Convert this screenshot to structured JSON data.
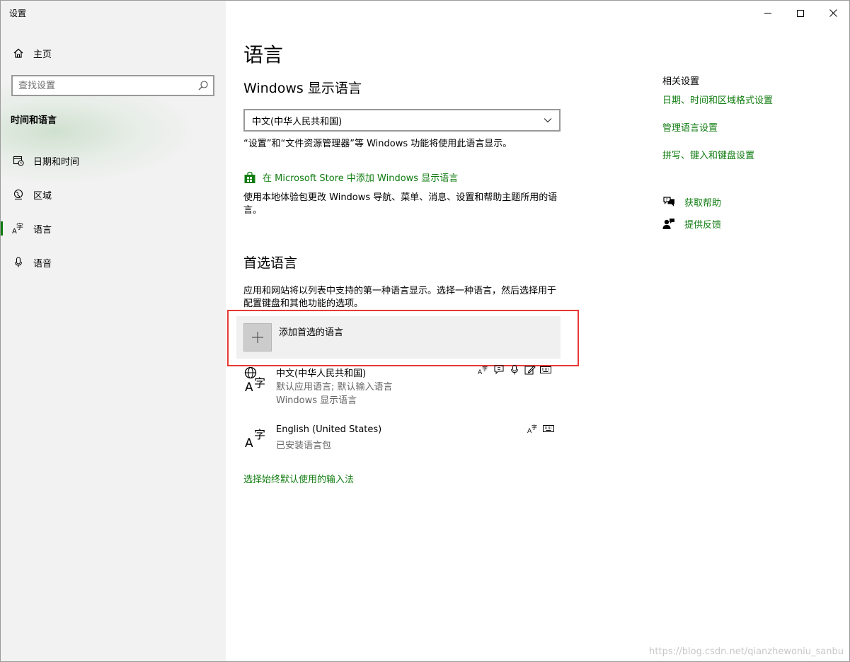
{
  "window": {
    "app_title": "设置",
    "controls": {
      "minimize": "minimize-icon",
      "maximize": "maximize-icon",
      "close": "close-icon"
    }
  },
  "sidebar": {
    "home_label": "主页",
    "search_placeholder": "查找设置",
    "section_title": "时间和语言",
    "items": [
      {
        "label": "日期和时间",
        "icon": "calendar-clock-icon"
      },
      {
        "label": "区域",
        "icon": "globe-icon"
      },
      {
        "label": "语言",
        "icon": "language-icon",
        "active": true
      },
      {
        "label": "语音",
        "icon": "microphone-icon"
      }
    ]
  },
  "main": {
    "title": "语言",
    "display_language": {
      "heading": "Windows 显示语言",
      "selected": "中文(中华人民共和国)",
      "description": "“设置”和“文件资源管理器”等 Windows 功能将使用此语言显示。",
      "store_link": "在 Microsoft Store 中添加 Windows 显示语言",
      "store_description": "使用本地体验包更改 Windows 导航、菜单、消息、设置和帮助主题所用的语言。"
    },
    "preferred": {
      "heading": "首选语言",
      "description": "应用和网站将以列表中支持的第一种语言显示。选择一种语言，然后选择用于配置键盘和其他功能的选项。",
      "add_label": "添加首选的语言",
      "languages": [
        {
          "name": "中文(中华人民共和国)",
          "sub1": "默认应用语言; 默认输入语言",
          "sub2": "Windows 显示语言"
        },
        {
          "name": "English (United States)",
          "sub1": "已安装语言包"
        }
      ]
    },
    "bottom_link": "选择始终默认使用的输入法"
  },
  "related": {
    "heading": "相关设置",
    "links": [
      "日期、时间和区域格式设置",
      "管理语言设置",
      "拼写、键入和键盘设置"
    ],
    "help": "获取帮助",
    "feedback": "提供反馈"
  },
  "watermark": "https://blog.csdn.net/qianzhewoniu_sanbu",
  "colors": {
    "accent": "#107c10",
    "highlight": "#e53935",
    "sidebar_bg": "#f2f2f2"
  }
}
